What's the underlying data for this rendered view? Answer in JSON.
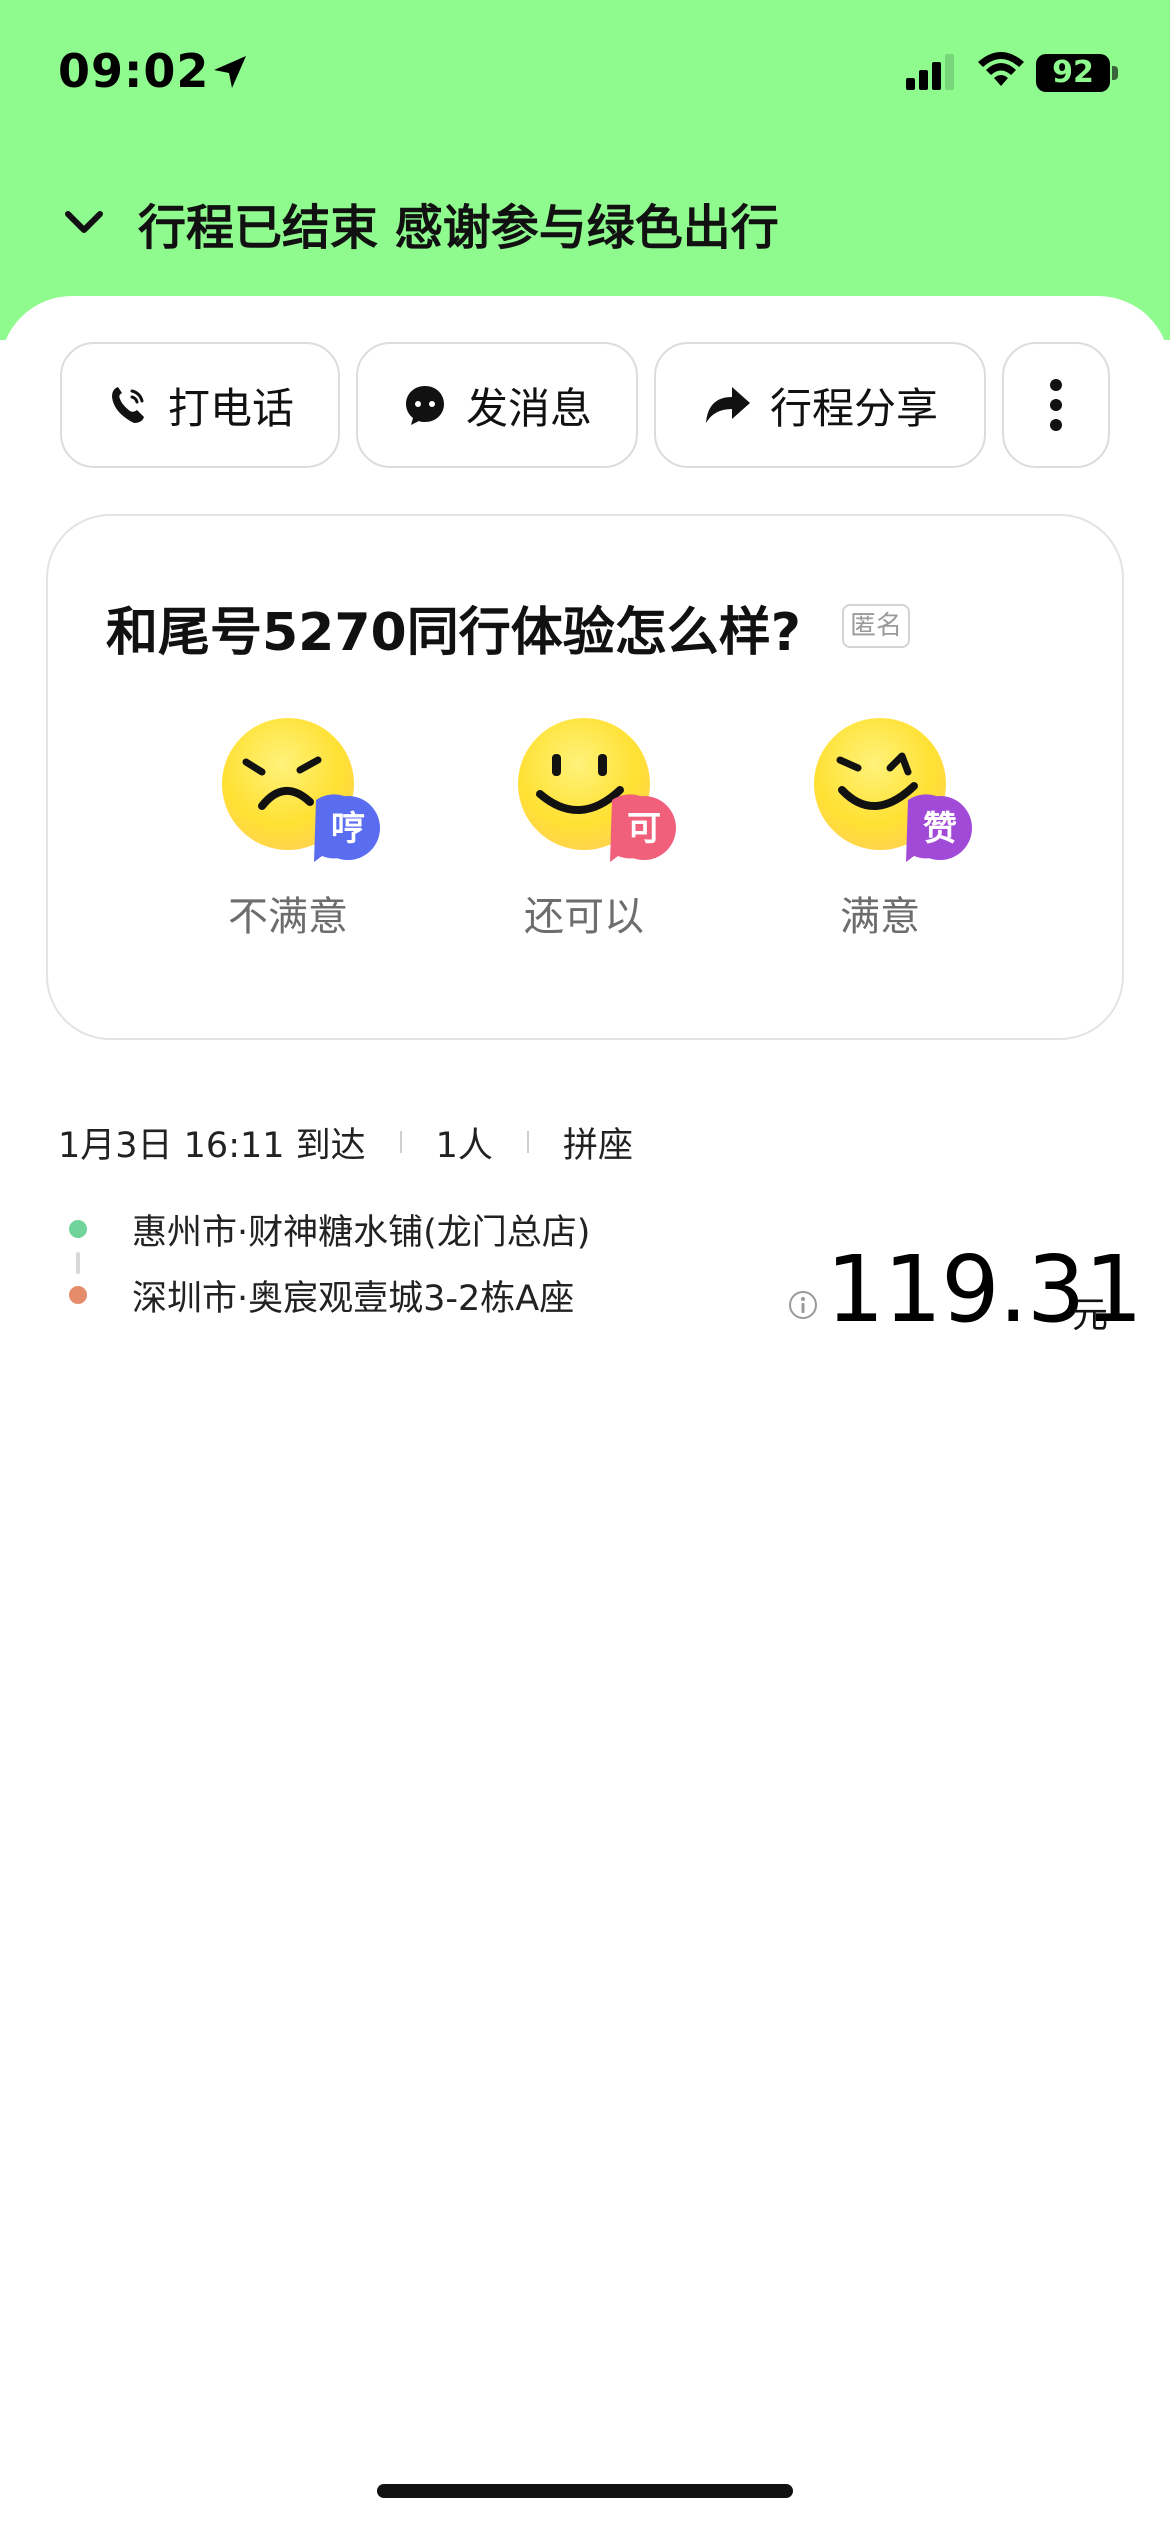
{
  "status_bar": {
    "time": "09:02",
    "battery": "92"
  },
  "header": {
    "title": "行程已结束 感谢参与绿色出行"
  },
  "actions": {
    "call_label": "打电话",
    "message_label": "发消息",
    "share_label": "行程分享"
  },
  "rating": {
    "title": "和尾号5270同行体验怎么样?",
    "anonymous_badge": "匿名",
    "options": [
      {
        "label": "不满意",
        "badge": "哼",
        "badge_color": "#5a6cf0"
      },
      {
        "label": "还可以",
        "badge": "可",
        "badge_color": "#f0607a"
      },
      {
        "label": "满意",
        "badge": "赞",
        "badge_color": "#a24ad8"
      }
    ]
  },
  "trip": {
    "arrival": "1月3日 16:11 到达",
    "passengers": "1人",
    "ride_type": "拼座",
    "origin": "惠州市·财神糖水铺(龙门总店)",
    "destination": "深圳市·奥宸观壹城3-2栋A座",
    "price": "119.31",
    "currency": "元"
  },
  "colors": {
    "header_bg": "#8ffb8f",
    "origin_dot": "#6fd39a",
    "destination_dot": "#e58c6a"
  }
}
